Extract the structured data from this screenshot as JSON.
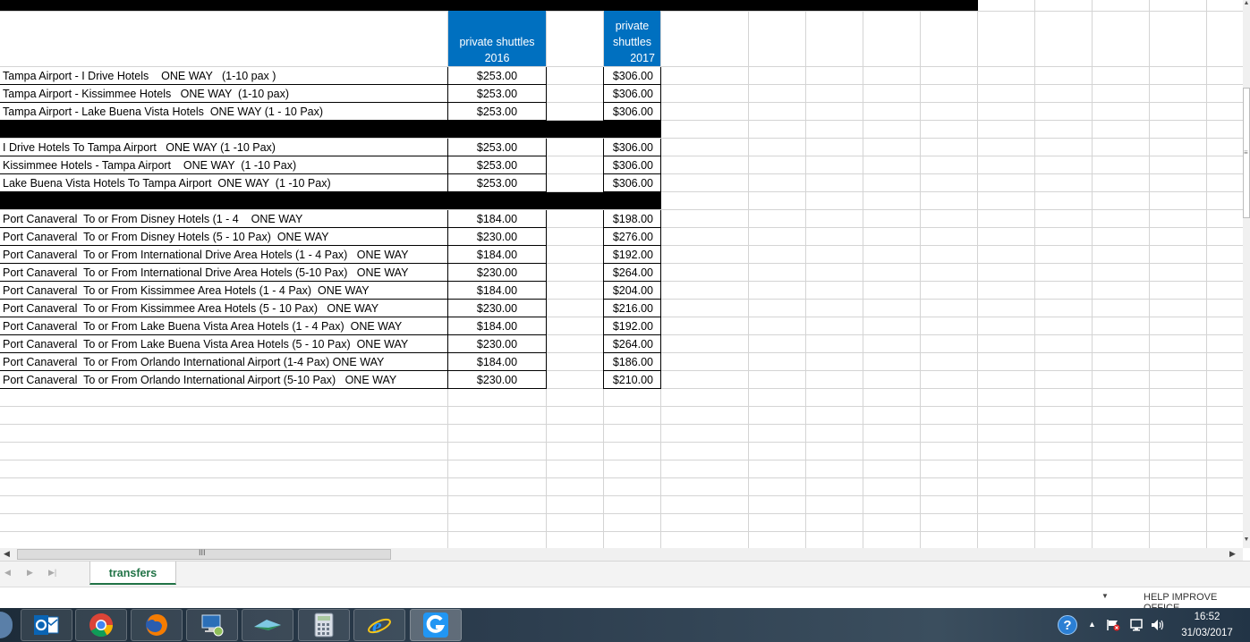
{
  "sheet": {
    "headers": {
      "col2016": "private  shuttles 2016",
      "col2016_lines": [
        "private  shuttles",
        "2016"
      ],
      "col2017_lines": [
        "private",
        "shuttles",
        "2017"
      ]
    },
    "rows": [
      {
        "desc": "Tampa Airport - I Drive Hotels    ONE WAY   (1-10 pax )",
        "p2016": "$253.00",
        "p2017": "$306.00"
      },
      {
        "desc": "Tampa Airport - Kissimmee Hotels   ONE WAY  (1-10 pax)",
        "p2016": "$253.00",
        "p2017": "$306.00"
      },
      {
        "desc": "Tampa Airport - Lake Buena Vista Hotels  ONE WAY (1 - 10 Pax)",
        "p2016": "$253.00",
        "p2017": "$306.00"
      },
      {
        "desc": "I Drive Hotels To Tampa Airport   ONE WAY (1 -10 Pax)",
        "p2016": "$253.00",
        "p2017": "$306.00"
      },
      {
        "desc": "Kissimmee Hotels - Tampa Airport    ONE WAY  (1 -10 Pax)",
        "p2016": "$253.00",
        "p2017": "$306.00"
      },
      {
        "desc": "Lake Buena Vista Hotels To Tampa Airport  ONE WAY  (1 -10 Pax)",
        "p2016": "$253.00",
        "p2017": "$306.00"
      },
      {
        "desc": "Port Canaveral  To or From Disney Hotels (1 - 4    ONE WAY",
        "p2016": "$184.00",
        "p2017": "$198.00"
      },
      {
        "desc": "Port Canaveral  To or From Disney Hotels (5 - 10 Pax)  ONE WAY",
        "p2016": "$230.00",
        "p2017": "$276.00"
      },
      {
        "desc": "Port Canaveral  To or From International Drive Area Hotels (1 - 4 Pax)   ONE WAY",
        "p2016": "$184.00",
        "p2017": "$192.00"
      },
      {
        "desc": "Port Canaveral  To or From International Drive Area Hotels (5-10 Pax)   ONE WAY",
        "p2016": "$230.00",
        "p2017": "$264.00"
      },
      {
        "desc": "Port Canaveral  To or From Kissimmee Area Hotels (1 - 4 Pax)  ONE WAY",
        "p2016": "$184.00",
        "p2017": "$204.00"
      },
      {
        "desc": "Port Canaveral  To or From Kissimmee Area Hotels (5 - 10 Pax)   ONE WAY",
        "p2016": "$230.00",
        "p2017": "$216.00"
      },
      {
        "desc": "Port Canaveral  To or From Lake Buena Vista Area Hotels (1 - 4 Pax)  ONE WAY",
        "p2016": "$184.00",
        "p2017": "$192.00"
      },
      {
        "desc": "Port Canaveral  To or From Lake Buena Vista Area Hotels (5 - 10 Pax)  ONE WAY",
        "p2016": "$230.00",
        "p2017": "$264.00"
      },
      {
        "desc": "Port Canaveral  To or From Orlando International Airport (1-4 Pax) ONE WAY",
        "p2016": "$184.00",
        "p2017": "$186.00"
      },
      {
        "desc": "Port Canaveral  To or From Orlando International Airport (5-10 Pax)   ONE WAY",
        "p2016": "$230.00",
        "p2017": "$210.00"
      }
    ]
  },
  "tabs": {
    "active": "transfers"
  },
  "status": {
    "help": "HELP IMPROVE OFFICE"
  },
  "scroll": {
    "grip": "III"
  },
  "taskbar": {
    "apps": [
      "outlook-icon",
      "chrome-icon",
      "firefox-icon",
      "network-pc-icon",
      "onedrive-icon",
      "calculator-icon",
      "internet-explorer-icon",
      "g-app-icon"
    ],
    "clock_time": "16:52",
    "clock_date": "31/03/2017",
    "help_glyph": "?"
  },
  "colors": {
    "header_blue": "#0070c0",
    "excel_green": "#217346"
  }
}
